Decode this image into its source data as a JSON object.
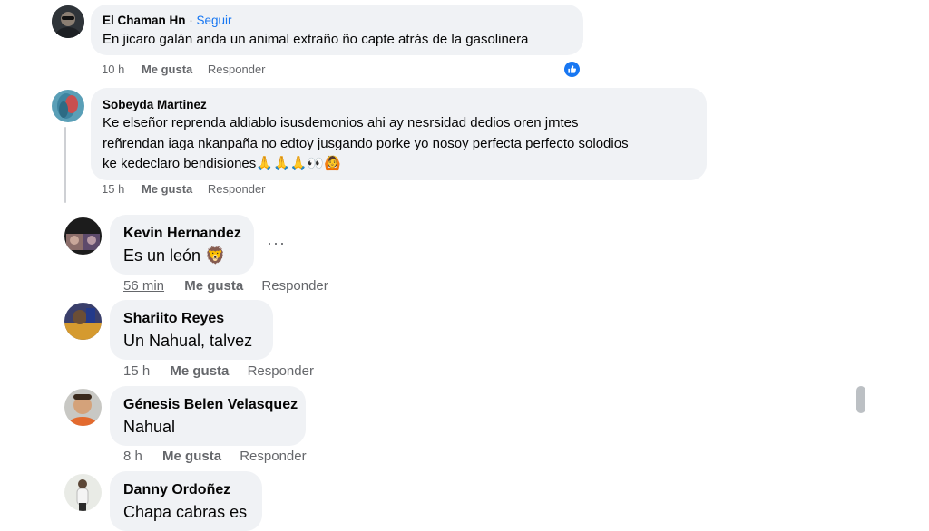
{
  "comments": [
    {
      "author": "El Chaman Hn",
      "separator": " · ",
      "follow": "Seguir",
      "text": "En jicaro galán anda un animal extraño ño capte atrás de la gasolinera",
      "time": "10 h",
      "like": "Me gusta",
      "reply": "Responder",
      "reaction_icon": "like-icon"
    },
    {
      "author": "Sobeyda Martinez",
      "text_lines": [
        "Ke elseñor reprenda aldiablo isusdemonios ahi ay nesrsidad dedios oren jrntes",
        "reñrendan iaga nkanpaña no edtoy jusgando porke yo nosoy perfecta perfecto solodios",
        "ke kedeclaro bendisiones🙏🙏🙏👀🙆"
      ],
      "time": "15 h",
      "like": "Me gusta",
      "reply": "Responder"
    },
    {
      "author": "Kevin Hernandez",
      "text": "Es un león 🦁",
      "time": "56 min",
      "like": "Me gusta",
      "reply": "Responder",
      "more": "···"
    },
    {
      "author": "Shariito Reyes",
      "text": "Un Nahual, talvez",
      "time": "15 h",
      "like": "Me gusta",
      "reply": "Responder"
    },
    {
      "author": "Génesis Belen Velasquez",
      "text": "Nahual",
      "time": "8 h",
      "like": "Me gusta",
      "reply": "Responder"
    },
    {
      "author": "Danny Ordoñez",
      "text": "Chapa cabras es"
    }
  ],
  "colors": {
    "bubble": "#f0f2f5",
    "meta": "#65676b",
    "link": "#1877f2"
  }
}
